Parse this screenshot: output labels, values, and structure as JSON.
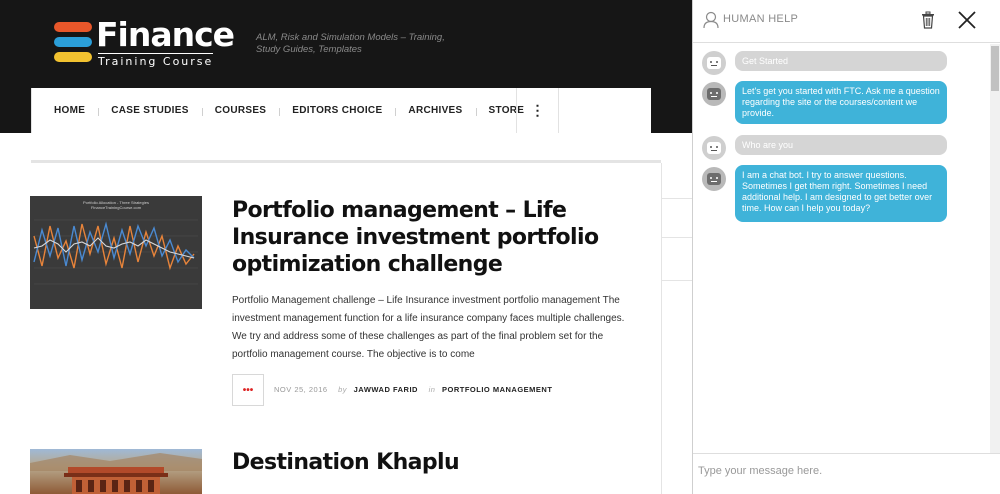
{
  "site": {
    "logo": {
      "title": "Finance",
      "subtitle": "Training Course"
    },
    "tagline": "ALM, Risk and Simulation Models – Training, Study Guides, Templates",
    "nav": [
      "HOME",
      "CASE STUDIES",
      "COURSES",
      "EDITORS CHOICE",
      "ARCHIVES",
      "STORE"
    ],
    "nav_more_icon": "vertical-ellipsis-icon"
  },
  "posts": [
    {
      "title": "Portfolio management – Life Insurance investment portfolio optimization challenge",
      "thumbnail": {
        "caption": "Portfolio Allocation - Three Strategies",
        "site": "FinanceTrainingCourse.com"
      },
      "excerpt": "Portfolio Management challenge – Life Insurance investment portfolio management The investment management function for a life insurance company faces multiple challenges. We try and address some of these challenges as part of the final problem set for the portfolio management course.  The objective is to come",
      "more_label": "•••",
      "date": "NOV 25, 2016",
      "by_label": "by",
      "author": "JAWWAD FARID",
      "in_label": "in",
      "category": "PORTFOLIO MANAGEMENT"
    },
    {
      "title": "Destination Khaplu"
    }
  ],
  "chat": {
    "title": "HUMAN HELP",
    "messages": [
      {
        "from": "user",
        "text": "Get Started"
      },
      {
        "from": "bot",
        "text": "Let's get you started with FTC. Ask me a question regarding the site or the courses/content we provide."
      },
      {
        "from": "user",
        "text": "Who are you"
      },
      {
        "from": "bot",
        "text": "I am a chat bot. I try to answer questions. Sometimes I get them right. Sometimes I need additional help. I am designed to get better over time. How can I help you today?"
      }
    ],
    "input_placeholder": "Type your message here."
  },
  "colors": {
    "header_bg": "#161616",
    "bot_bubble": "#3fb3d9",
    "user_bubble": "#d5d5d5",
    "accent_red": "#dd2222"
  }
}
